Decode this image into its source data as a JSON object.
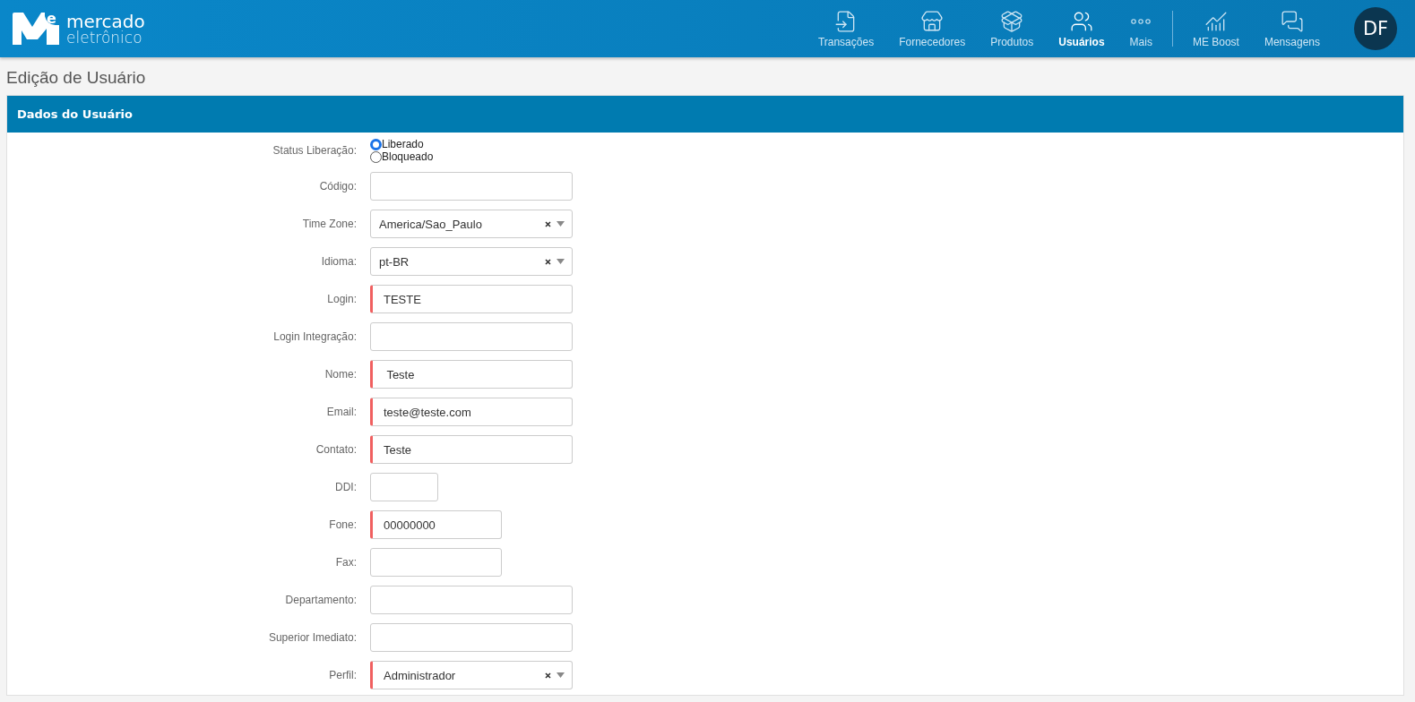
{
  "brand": {
    "line1": "mercado",
    "line2": "eletrônico",
    "mark": "e"
  },
  "nav_main": [
    {
      "label": "Transações",
      "selected": false
    },
    {
      "label": "Fornecedores",
      "selected": false
    },
    {
      "label": "Produtos",
      "selected": false
    },
    {
      "label": "Usuários",
      "selected": true
    },
    {
      "label": "Mais",
      "selected": false
    }
  ],
  "nav_extra": [
    {
      "label": "ME Boost",
      "selected": false
    },
    {
      "label": "Mensagens",
      "selected": false
    }
  ],
  "avatar": "DF",
  "page_title": "Edição de Usuário",
  "panel_title": "Dados do Usuário",
  "fields": [
    {
      "kind": "radio",
      "label": "Status Liberação:",
      "options": [
        {
          "label": "Liberado",
          "selected": true
        },
        {
          "label": "Bloqueado",
          "selected": false
        }
      ]
    },
    {
      "kind": "input",
      "label": "Código:",
      "required": false
    },
    {
      "kind": "select",
      "label": "Time Zone:",
      "value": "America/Sao_Paulo",
      "required": false
    },
    {
      "kind": "select",
      "label": "Idioma:",
      "value": "pt-BR",
      "required": false
    },
    {
      "kind": "input",
      "label": "Login:",
      "value": "TESTE",
      "required": true
    },
    {
      "kind": "input",
      "label": "Login Integração:",
      "required": false
    },
    {
      "kind": "input",
      "label": "Nome:",
      "value": " Teste",
      "required": true
    },
    {
      "kind": "input",
      "label": "Email:",
      "value": "teste@teste.com",
      "required": true
    },
    {
      "kind": "input",
      "label": "Contato:",
      "value": "Teste",
      "required": true
    },
    {
      "kind": "input",
      "label": "DDI:",
      "required": false
    },
    {
      "kind": "input",
      "label": "Fone:",
      "value": "00000000",
      "required": true
    },
    {
      "kind": "input",
      "label": "Fax:",
      "required": false
    },
    {
      "kind": "input",
      "label": "Departamento:",
      "required": false
    },
    {
      "kind": "input",
      "label": "Superior Imediato:",
      "required": false
    },
    {
      "kind": "select",
      "label": "Perfil:",
      "value": "Administrador",
      "required": true
    }
  ]
}
